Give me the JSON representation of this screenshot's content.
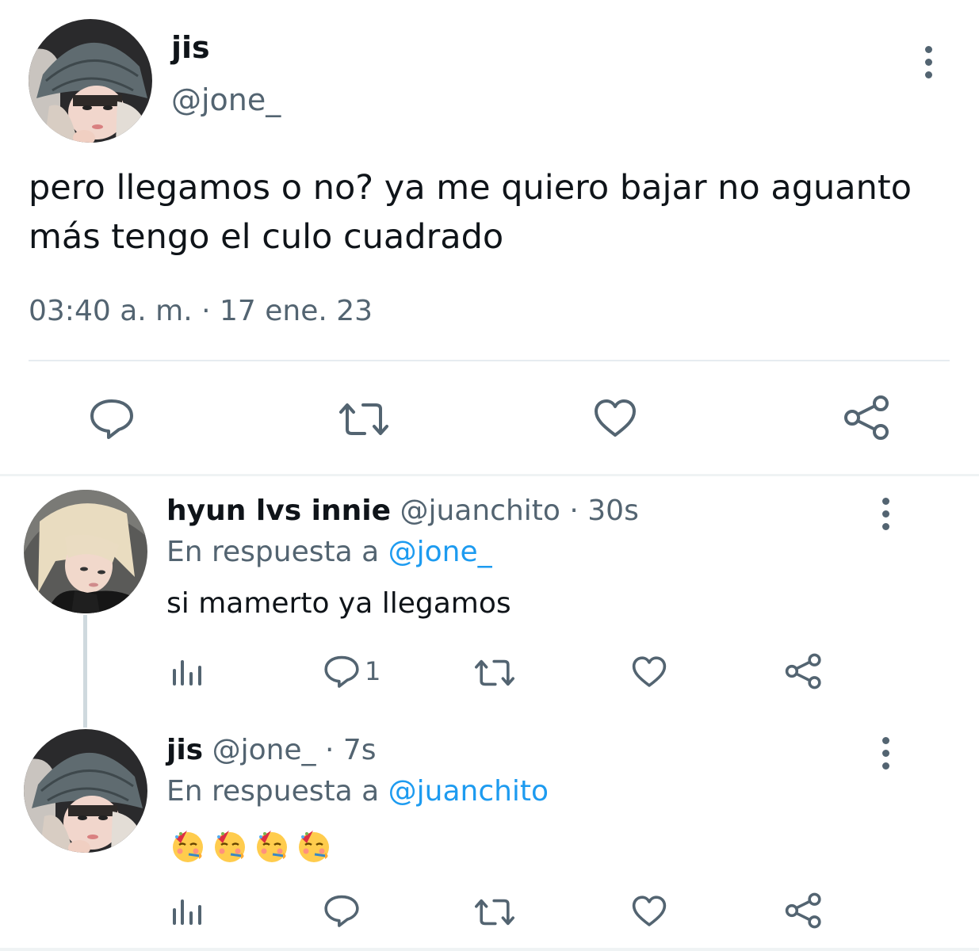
{
  "main_tweet": {
    "author_name": "jis",
    "author_handle": "@jone_",
    "text": "pero llegamos o no? ya me quiero bajar no aguanto más tengo el culo cuadrado",
    "timestamp": "03:40 a. m. · 17 ene. 23",
    "actions": [
      {
        "icon": "reply-icon"
      },
      {
        "icon": "retweet-icon"
      },
      {
        "icon": "like-icon"
      },
      {
        "icon": "share-icon"
      }
    ]
  },
  "replies": [
    {
      "author_name": "hyun lvs innie",
      "author_handle": "@juanchito",
      "separator": " · ",
      "time": "30s",
      "reply_prefix": "En respuesta a ",
      "reply_to": "@jone_",
      "text": "si mamerto ya llegamos",
      "reply_count": "1"
    },
    {
      "author_name": "jis",
      "author_handle": "@jone_",
      "separator": " · ",
      "time": "7s",
      "reply_prefix": "En respuesta a ",
      "reply_to": "@juanchito",
      "emojis": [
        "partying-face",
        "partying-face",
        "partying-face",
        "partying-face"
      ]
    }
  ],
  "colors": {
    "text": "#0f1419",
    "secondary": "#536471",
    "link": "#1d9bf0",
    "divider": "#eff3f4"
  }
}
